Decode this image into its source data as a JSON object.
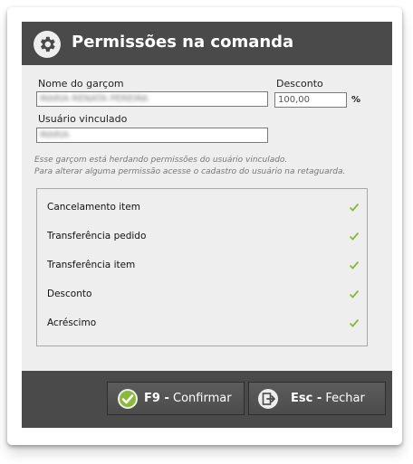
{
  "dialog": {
    "title": "Permissões na comanda",
    "header_icon": "gear-icon"
  },
  "form": {
    "waiter_name_label": "Nome do garçom",
    "waiter_name_value": "MARIA RENATA PEREIRA",
    "discount_label": "Desconto",
    "discount_value": "100,00",
    "percent_symbol": "%",
    "linked_user_label": "Usuário vinculado",
    "linked_user_value": "MARIA"
  },
  "notes": {
    "line1": "Esse garçom está herdando permissões do usuário vinculado.",
    "line2": "Para alterar alguma permissão acesse o cadastro do usuário na retaguarda."
  },
  "permissions": [
    {
      "label": "Cancelamento item",
      "checked": true
    },
    {
      "label": "Transferência pedido",
      "checked": true
    },
    {
      "label": "Transferência item",
      "checked": true
    },
    {
      "label": "Desconto",
      "checked": true
    },
    {
      "label": "Acréscimo",
      "checked": true
    }
  ],
  "buttons": {
    "confirm_key": "F9 -",
    "confirm_label": "Confirmar",
    "confirm_icon": "check-circle-icon",
    "close_key": "Esc -",
    "close_label": "Fechar",
    "close_icon": "exit-door-icon"
  },
  "colors": {
    "header_bg": "#4a4a4a",
    "body_bg": "#eeeeee",
    "check_green": "#8ab83a"
  }
}
